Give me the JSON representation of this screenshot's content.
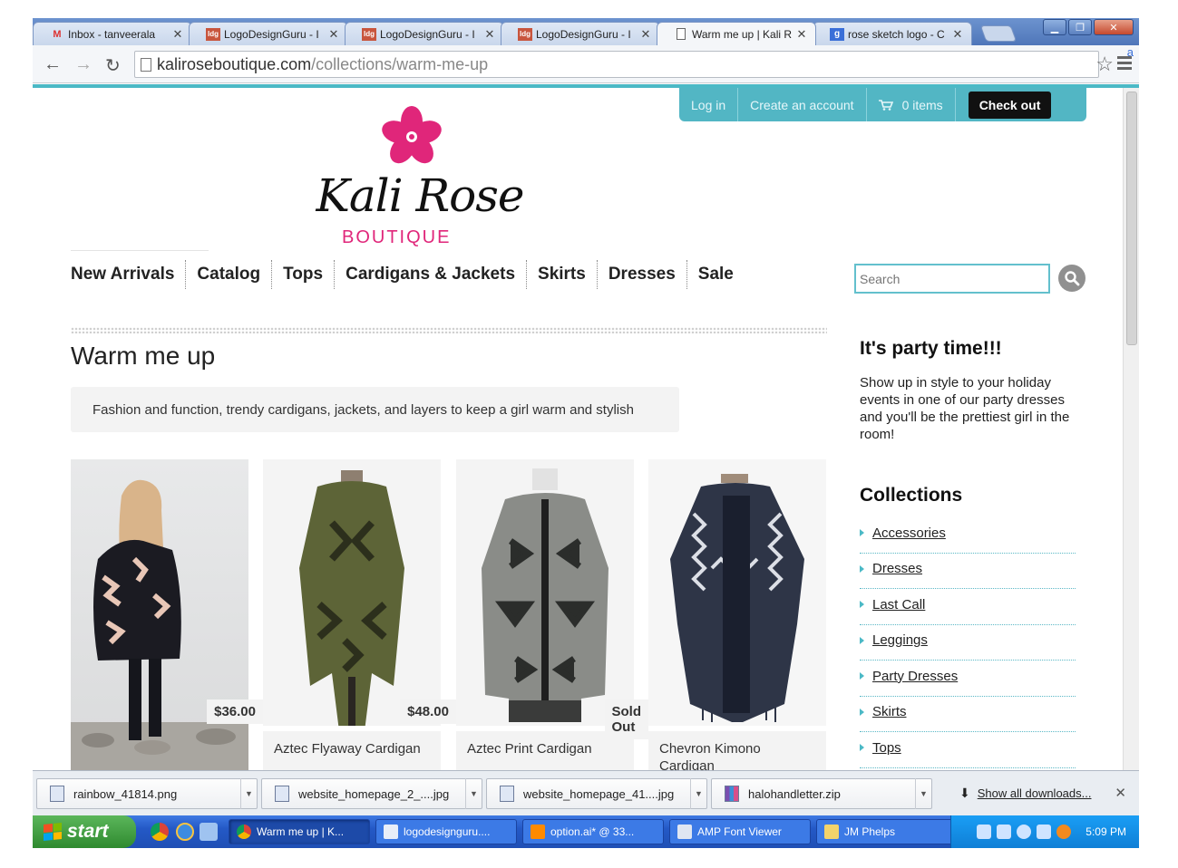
{
  "browser": {
    "tabs": [
      {
        "title": "Inbox - tanveerala",
        "icon": "gmail-icon",
        "active": false
      },
      {
        "title": "LogoDesignGuru - I",
        "icon": "logodesignguru-icon",
        "active": false
      },
      {
        "title": "LogoDesignGuru - I",
        "icon": "logodesignguru-icon",
        "active": false
      },
      {
        "title": "LogoDesignGuru - I",
        "icon": "logodesignguru-icon",
        "active": false
      },
      {
        "title": "Warm me up | Kali R",
        "icon": "page-icon",
        "active": true
      },
      {
        "title": "rose sketch logo - C",
        "icon": "google-icon",
        "active": false
      }
    ],
    "url_domain": "kaliroseboutique.com",
    "url_path": "/collections/warm-me-up",
    "extension_label": "a"
  },
  "header": {
    "login": "Log in",
    "create_account": "Create an account",
    "cart": "0 items",
    "checkout": "Check out"
  },
  "logo": {
    "name": "Kali Rose",
    "subtitle": "BOUTIQUE",
    "flower_color": "#e0267a"
  },
  "nav": [
    "New Arrivals",
    "Catalog",
    "Tops",
    "Cardigans & Jackets",
    "Skirts",
    "Dresses",
    "Sale"
  ],
  "search": {
    "placeholder": "Search"
  },
  "collection": {
    "title": "Warm me up",
    "description": "Fashion and function, trendy cardigans, jackets, and layers to keep a girl warm and stylish"
  },
  "products": [
    {
      "name": "",
      "price": ""
    },
    {
      "name": "Aztec Flyaway Cardigan",
      "price": "$36.00"
    },
    {
      "name": "Aztec Print Cardigan",
      "price": "$48.00"
    },
    {
      "name": "Chevron Kimono Cardigan",
      "price": "Sold Out"
    }
  ],
  "sidebar": {
    "promo_title": "It's party time!!!",
    "promo_text": "Show up in style to your holiday events in one of our party dresses and you'll be the prettiest girl in the room!",
    "collections_title": "Collections",
    "collections": [
      "Accessories",
      "Dresses",
      "Last Call",
      "Leggings",
      "Party Dresses",
      "Skirts",
      "Tops"
    ]
  },
  "downloads": {
    "files": [
      "rainbow_41814.png",
      "website_homepage_2_....jpg",
      "website_homepage_41....jpg",
      "halohandletter.zip"
    ],
    "show_all": "Show all downloads..."
  },
  "taskbar": {
    "start": "start",
    "tasks": [
      "Warm me up | K...",
      "logodesignguru....",
      "option.ai* @ 33...",
      "AMP Font Viewer",
      "JM Phelps"
    ],
    "clock": "5:09 PM"
  },
  "colors": {
    "accent": "#52b6c4",
    "brand_pink": "#e0267a"
  }
}
